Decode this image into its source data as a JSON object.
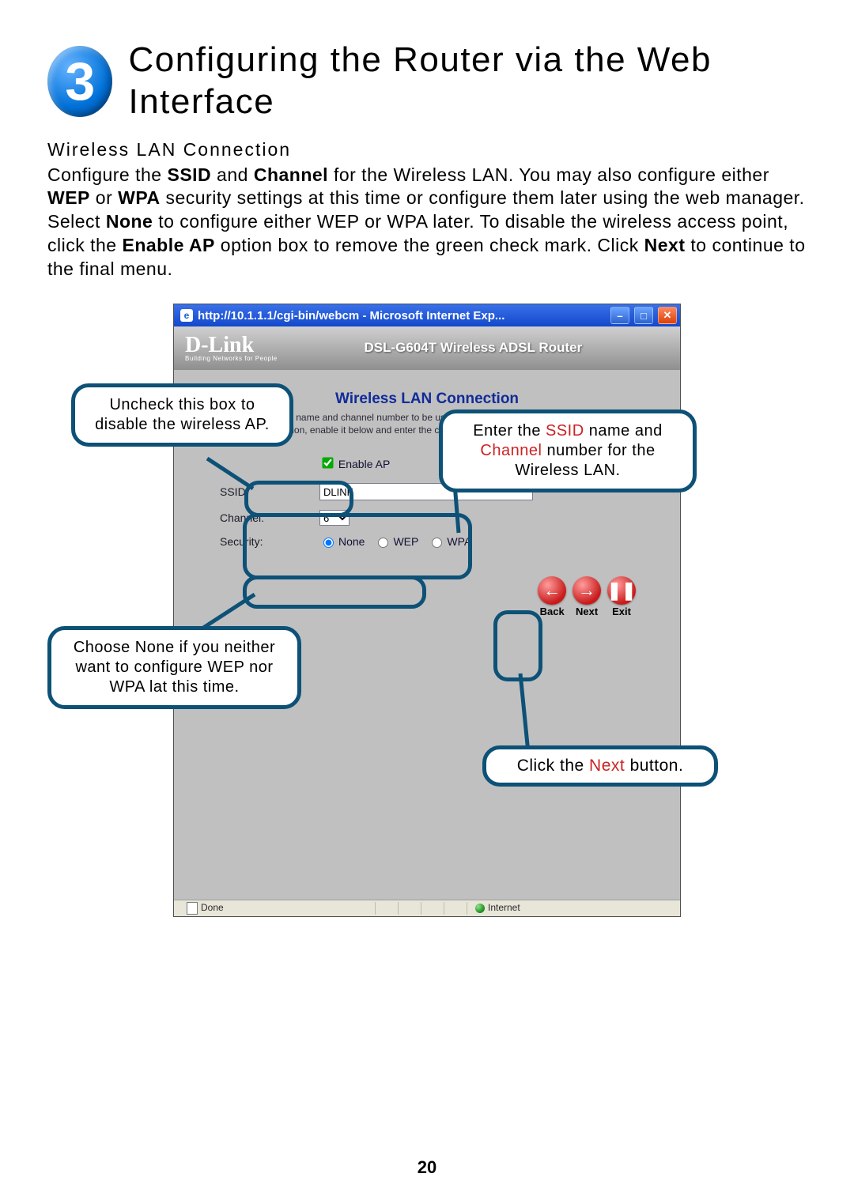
{
  "step": {
    "number": "3",
    "title": "Configuring the Router via the Web Interface"
  },
  "intro": {
    "subhead": "Wireless LAN Connection",
    "body_html": "Configure the <b>SSID</b> and <b>Channel</b> for the Wireless LAN. You may also configure either <b>WEP</b> or <b>WPA</b> security settings at this time or configure them later using the web manager. Select <b>None</b> to configure either WEP or WPA later. To disable the wireless access point, click the <b>Enable AP</b> option box to remove the green check mark. Click <b>Next</b> to continue to the final menu."
  },
  "window": {
    "title": "http://10.1.1.1/cgi-bin/webcm - Microsoft Internet Exp...",
    "brand": "D-Link",
    "brand_tag": "Building Networks for People",
    "model": "DSL-G604T Wireless ADSL Router",
    "section_title": "Wireless LAN Connection",
    "section_desc": "Enter the SSID name and channel number to be used for the Wireless LAN. If you wish to use encryption, enable it below and enter the correct values. Click Next to continue.",
    "enable_ap": {
      "label": "Enable AP",
      "checked": true
    },
    "ssid": {
      "label": "SSID:",
      "value": "DLINK"
    },
    "channel": {
      "label": "Channel:",
      "value": "6"
    },
    "security": {
      "label": "Security:",
      "options": [
        "None",
        "WEP",
        "WPA"
      ],
      "selected": "None"
    },
    "nav": {
      "back": "Back",
      "next": "Next",
      "exit": "Exit"
    },
    "status": {
      "done": "Done",
      "zone": "Internet"
    }
  },
  "callouts": {
    "uncheck": "Uncheck this box to disable the wireless AP.",
    "ssid_html": "Enter the <span class='hl-red'>SSID</span> name and <span class='hl-red'>Channel</span> number for the Wireless LAN.",
    "none": "Choose None if you neither want to configure WEP nor WPA lat this time.",
    "next_html": "Click the <span class='hl-red'>Next</span> button."
  },
  "page_number": "20"
}
